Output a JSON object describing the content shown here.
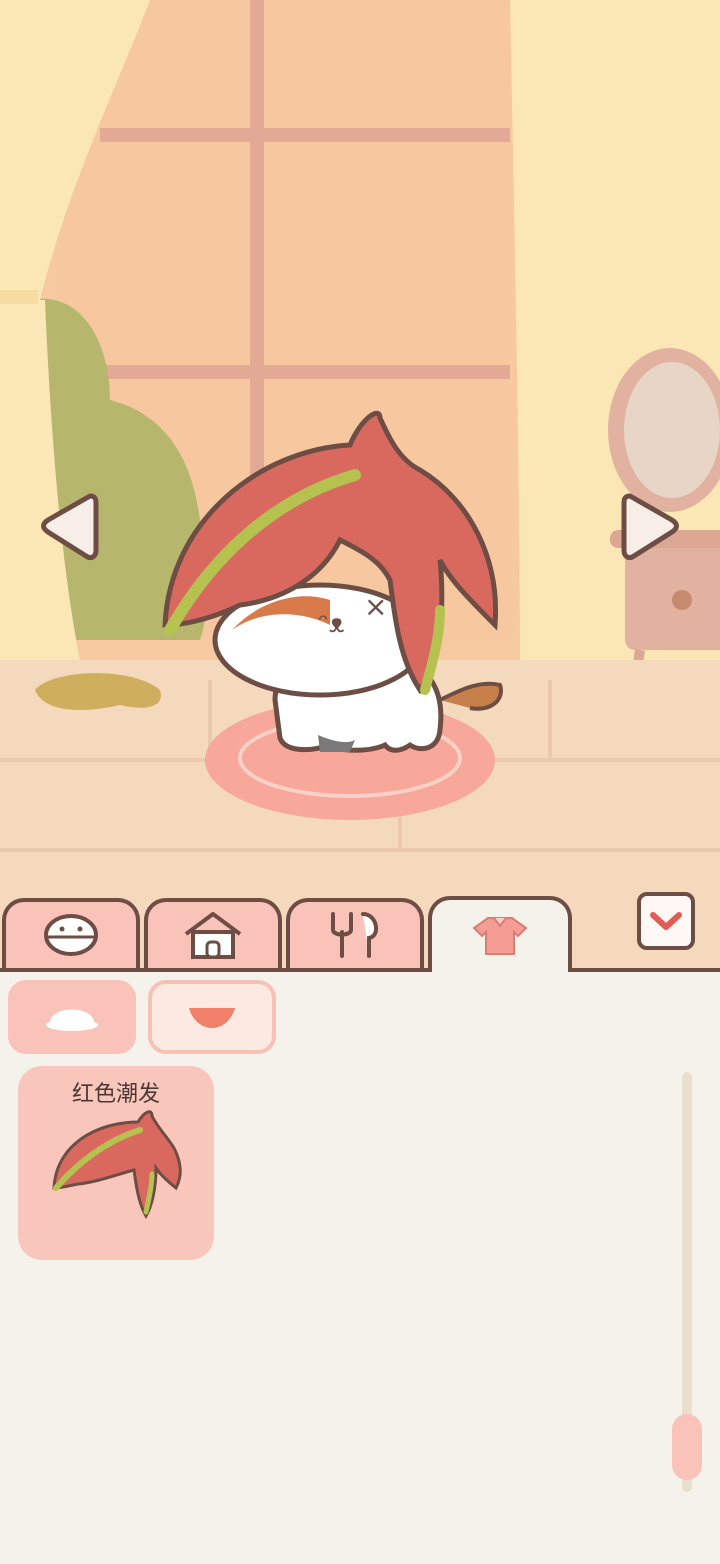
{
  "scene": {
    "colors": {
      "wall": "#f6c9a0",
      "curtain": "#fbe6b6",
      "floor": "#f4d9bd",
      "rug": "#f7a89a",
      "hair": "#d9695e",
      "accent": "#a8c050"
    }
  },
  "nav": {
    "prev_icon": "left-triangle-icon",
    "next_icon": "right-triangle-icon"
  },
  "tabs": [
    {
      "icon": "cat-face-icon"
    },
    {
      "icon": "house-icon"
    },
    {
      "icon": "fork-knife-icon"
    },
    {
      "icon": "shirt-icon"
    }
  ],
  "close_toggle": {
    "icon": "chevron-down-icon"
  },
  "subtabs": [
    {
      "icon": "hat-icon"
    },
    {
      "icon": "collar-icon"
    }
  ],
  "items": [
    {
      "label": "红色潮发",
      "icon": "red-hair-icon"
    }
  ]
}
